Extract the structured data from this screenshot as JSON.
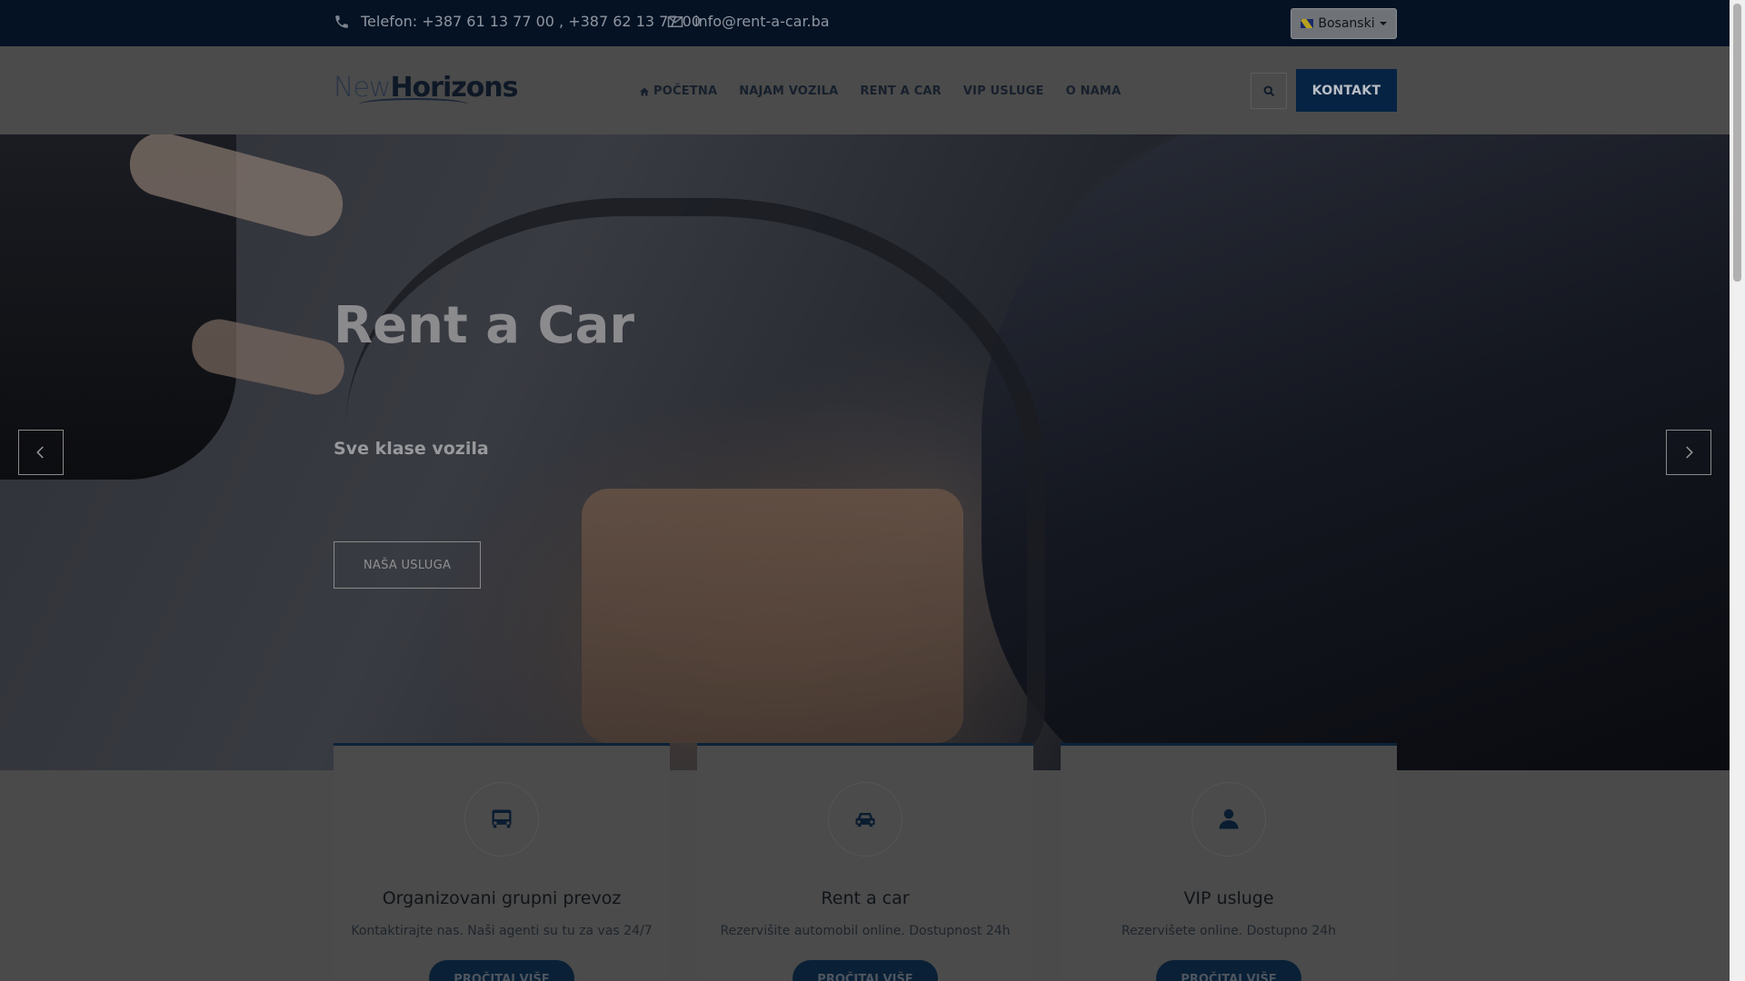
{
  "topbar": {
    "phone": "Telefon: +387 61 13 77 00 , +387 62 13 77 00",
    "email": "info@rent-a-car.ba",
    "language": "Bosanski"
  },
  "header": {
    "logo_part1": "New",
    "logo_part2": "Horizons",
    "nav": [
      "POČETNA",
      "NAJAM VOZILA",
      "RENT A CAR",
      "VIP USLUGE",
      "O NAMA"
    ],
    "contact_label": "KONTAKT"
  },
  "hero": {
    "title": "Rent a Car",
    "subtitle": "Sve klase vozila",
    "button": "NAŠA USLUGA"
  },
  "cards": [
    {
      "icon": "bus-icon",
      "title": "Organizovani grupni prevoz",
      "desc": "Kontaktirajte nas. Naši agenti su tu za vas 24/7",
      "button": "PROČITAJ VIŠE"
    },
    {
      "icon": "car-icon",
      "title": "Rent a car",
      "desc": "Rezervišite automobil online. Dostupnost 24h",
      "button": "PROČITAJ VIŠE"
    },
    {
      "icon": "user-icon",
      "title": "VIP usluge",
      "desc": "Rezervišete online. Dostupno 24h",
      "button": "PROČITAJ VIŠE"
    }
  ]
}
